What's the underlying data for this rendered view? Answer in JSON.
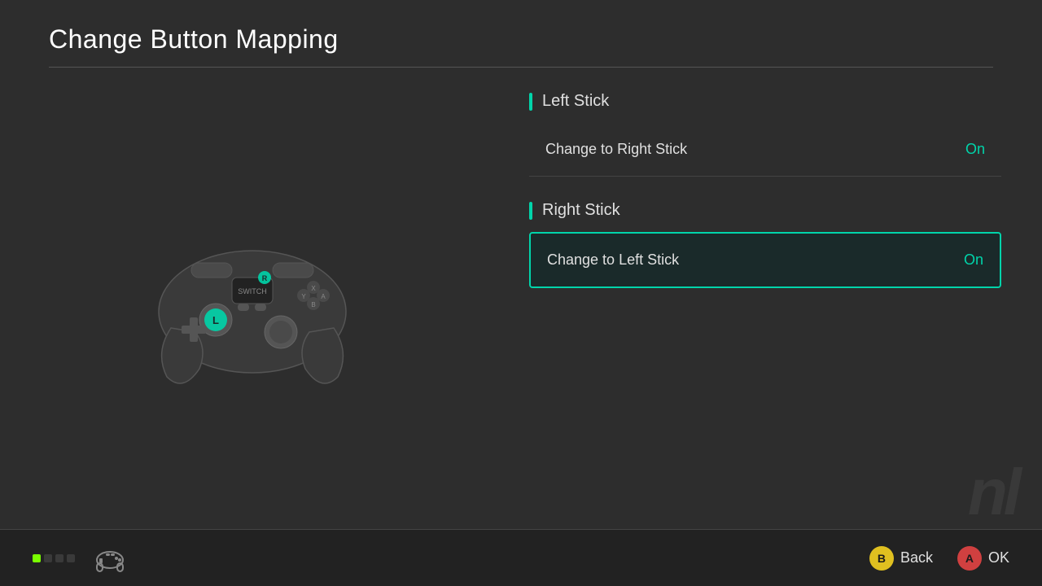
{
  "header": {
    "title": "Change Button Mapping"
  },
  "sections": [
    {
      "id": "left-stick",
      "title": "Left Stick",
      "settings": [
        {
          "id": "change-to-right-stick",
          "label": "Change to Right Stick",
          "value": "On",
          "selected": false
        }
      ]
    },
    {
      "id": "right-stick",
      "title": "Right Stick",
      "settings": [
        {
          "id": "change-to-left-stick",
          "label": "Change to Left Stick",
          "value": "On",
          "selected": true
        }
      ]
    }
  ],
  "bottom_bar": {
    "b_button": "B",
    "back_label": "Back",
    "a_button": "A",
    "ok_label": "OK"
  },
  "controller": {
    "r_label": "R",
    "l_label": "L"
  },
  "watermark": "nl"
}
